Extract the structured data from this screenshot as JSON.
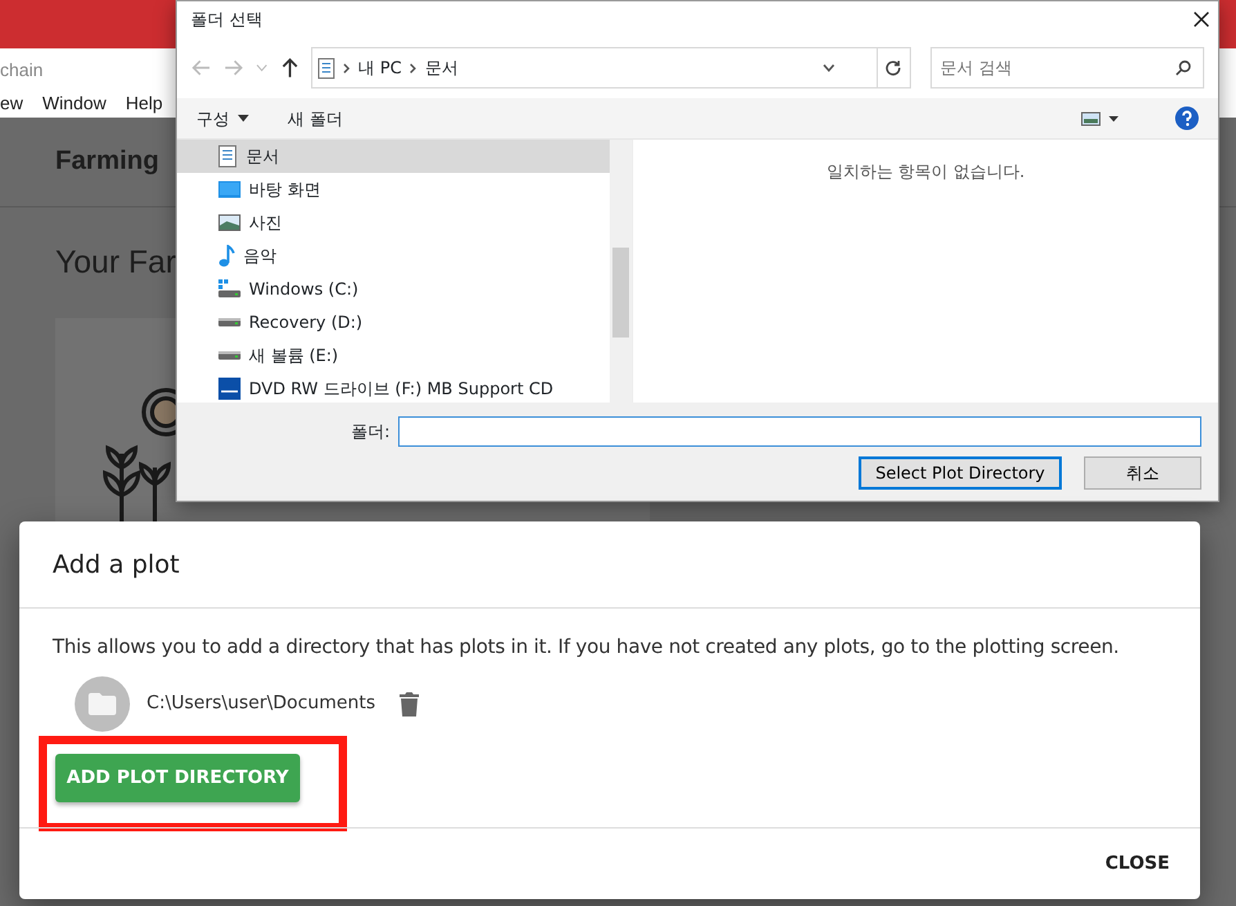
{
  "app": {
    "title_fragment": "chain",
    "menu": [
      "ew",
      "Window",
      "Help"
    ],
    "nav_title": "Farming",
    "heading": "Your Far"
  },
  "folder_dialog": {
    "title": "폴더 선택",
    "breadcrumb": [
      "내 PC",
      "문서"
    ],
    "search": {
      "placeholder": "문서 검색"
    },
    "organize": "구성",
    "new_folder": "새 폴더",
    "tree": [
      {
        "label": "문서",
        "kind": "documents",
        "selected": true
      },
      {
        "label": "바탕 화면",
        "kind": "desktop",
        "selected": false
      },
      {
        "label": "사진",
        "kind": "pictures",
        "selected": false
      },
      {
        "label": "음악",
        "kind": "music",
        "selected": false
      },
      {
        "label": "Windows (C:)",
        "kind": "system_drive",
        "selected": false
      },
      {
        "label": "Recovery (D:)",
        "kind": "drive",
        "selected": false
      },
      {
        "label": "새 볼륨 (E:)",
        "kind": "drive",
        "selected": false
      },
      {
        "label": "DVD RW 드라이브 (F:) MB Support CD",
        "kind": "dvd",
        "selected": false
      }
    ],
    "empty_message": "일치하는 항목이 없습니다.",
    "folder_label": "폴더:",
    "buttons": [
      {
        "label": "Select Plot Directory",
        "default": true
      },
      {
        "label": "취소",
        "default": false
      }
    ]
  },
  "modal": {
    "title": "Add a plot",
    "description": "This allows you to add a directory that has plots in it. If you have not created any plots, go to the plotting screen.",
    "directories": [
      "C:\\Users\\user\\Documents"
    ],
    "add_button": "ADD PLOT DIRECTORY",
    "add_button_highlighted": true,
    "close_button": "CLOSE"
  }
}
